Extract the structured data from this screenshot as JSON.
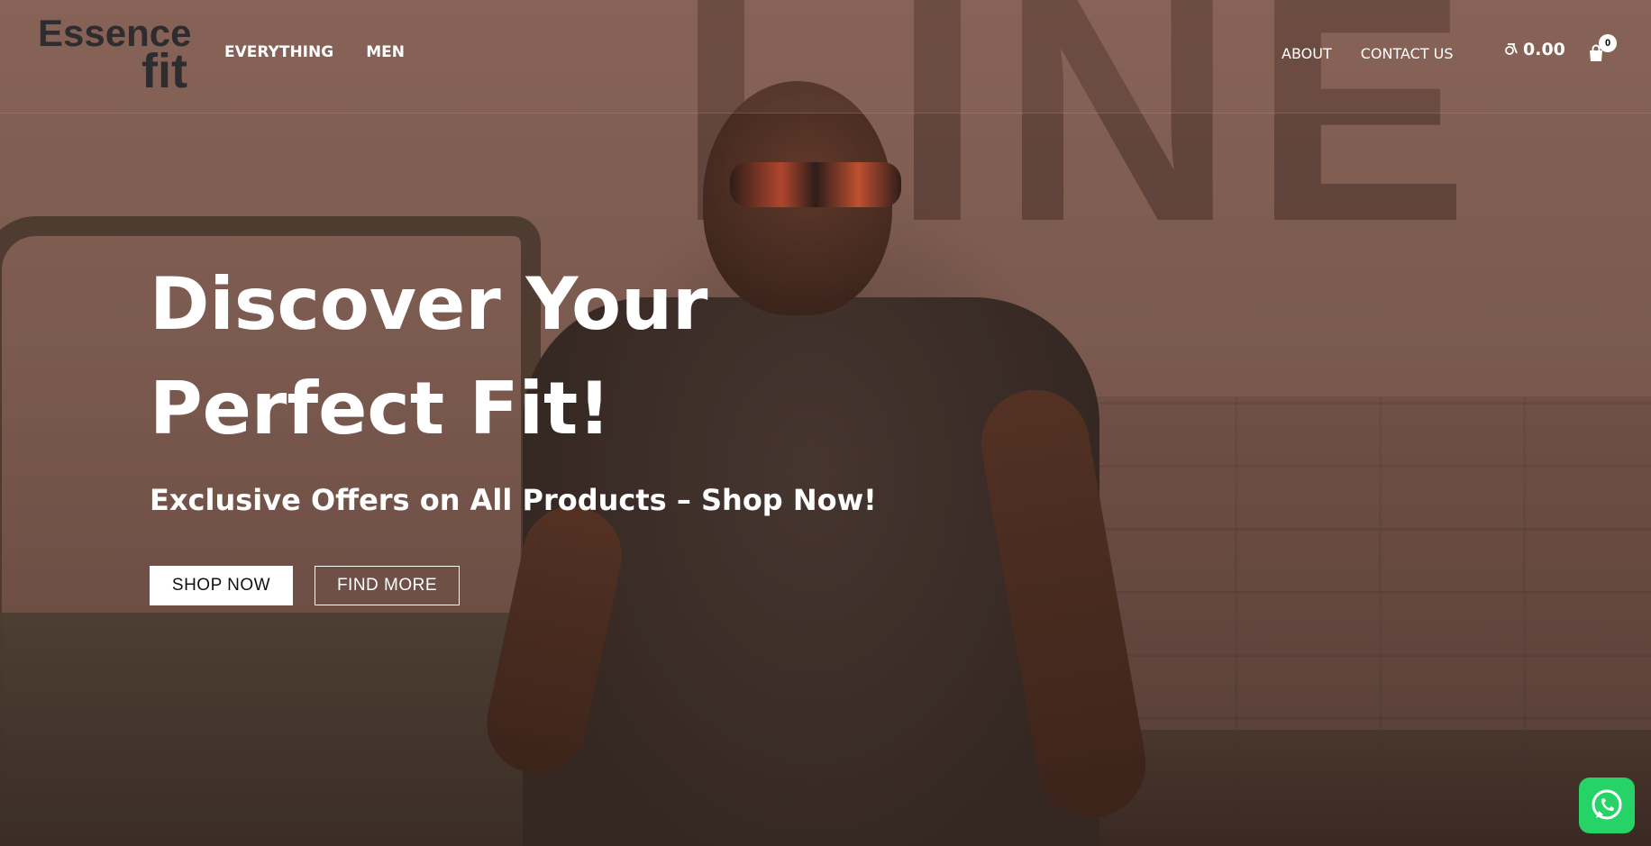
{
  "brand": {
    "logo_line1": "Essence",
    "logo_line2": "fit"
  },
  "nav": {
    "left_items": [
      {
        "label": "EVERYTHING"
      },
      {
        "label": "MEN"
      }
    ],
    "right_items": [
      {
        "label": "ABOUT"
      },
      {
        "label": "CONTACT US"
      }
    ]
  },
  "cart": {
    "currency_icon": "rupee-like-icon",
    "total": "0.00",
    "count": "0",
    "icon": "shopping-bag-icon"
  },
  "hero": {
    "title_line1": "Discover Your",
    "title_line2": "Perfect Fit!",
    "subtitle": "Exclusive Offers on All Products – Shop Now!",
    "shop_now_label": "SHOP NOW",
    "find_more_label": "FIND MORE"
  },
  "background": {
    "wall_text": "LINE"
  },
  "whatsapp": {
    "icon": "whatsapp-icon",
    "color": "#25d366"
  }
}
